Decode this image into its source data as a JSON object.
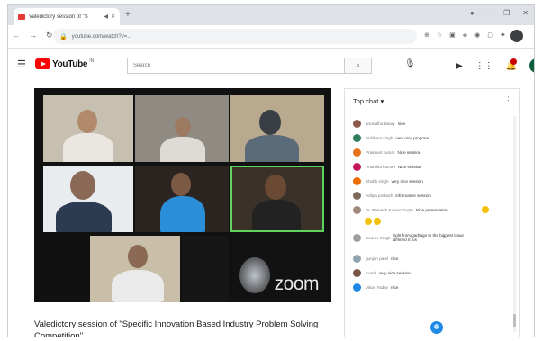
{
  "browser": {
    "tab_title": "Valedictory session of \"S",
    "address": "youtube.com/watch?v=...",
    "colors": {
      "tab_strip": "#dee1e6",
      "favicon": "#e53935"
    }
  },
  "youtube": {
    "logo_text": "YouTube",
    "country_code": "IN",
    "search_placeholder": "Search",
    "colors": {
      "brand": "#ff0000"
    }
  },
  "video": {
    "title": "Valedictory session of \"Specific Innovation Based Industry Problem Solving Competition\"",
    "watermark": "zoom",
    "participants": [
      "",
      "",
      "",
      "",
      "",
      "",
      "",
      "",
      ""
    ]
  },
  "chat": {
    "header": "Top chat",
    "messages": [
      {
        "name": "anuradha tiwary",
        "text": "nice"
      },
      {
        "name": "Siddhant singh",
        "text": "very nice program"
      },
      {
        "name": "Prashant kumar",
        "text": "Nice session"
      },
      {
        "name": "Anamika kumari",
        "text": "Nice session"
      },
      {
        "name": "Shubh singh",
        "text": "very nice session"
      },
      {
        "name": "Aditya prakash",
        "text": "informative session"
      },
      {
        "name": "Dr. Ramesh Kumar Gupta",
        "text": "Nice presentation"
      },
      {
        "name": "Sourav Singh",
        "text": "right from garbage to the biggest issue defined to us"
      },
      {
        "name": "gunjan patel",
        "text": "nice"
      },
      {
        "name": "Kunal",
        "text": "very nice session"
      },
      {
        "name": "Vikas Yadav",
        "text": "nice"
      }
    ]
  }
}
